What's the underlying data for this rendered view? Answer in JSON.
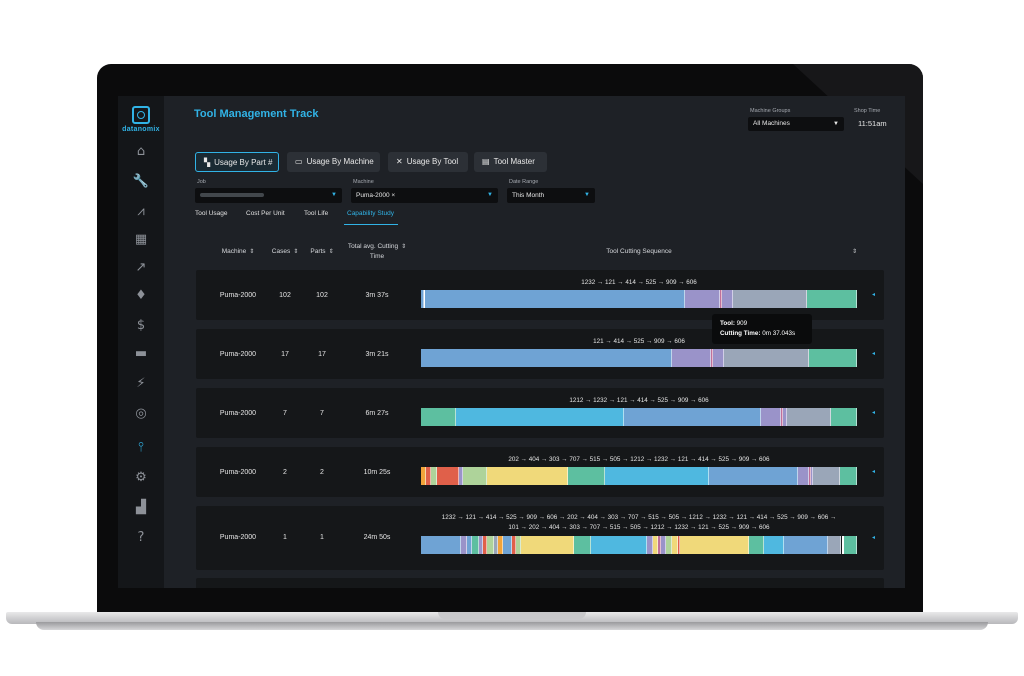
{
  "app": {
    "logo_text": "datanomix",
    "page_title": "Tool Management Track"
  },
  "header": {
    "machine_groups_label": "Machine Groups",
    "machine_groups_value": "All Machines",
    "shop_time_label": "Shop Time",
    "shop_time_value": "11:51am"
  },
  "sidebar": {
    "items": [
      {
        "name": "home-icon",
        "glyph": "⌂"
      },
      {
        "name": "wrench-icon",
        "glyph": "🔧"
      },
      {
        "name": "road-icon",
        "glyph": "⩘"
      },
      {
        "name": "machine-icon",
        "glyph": "▦"
      },
      {
        "name": "trend-icon",
        "glyph": "↗"
      },
      {
        "name": "award-icon",
        "glyph": "♦"
      },
      {
        "name": "dollar-icon",
        "glyph": "$"
      },
      {
        "name": "truck-icon",
        "glyph": "▬"
      },
      {
        "name": "chart-person-icon",
        "glyph": "⚡"
      },
      {
        "name": "search-gear-icon",
        "glyph": "◎"
      },
      {
        "name": "tool-icon",
        "glyph": "⫯"
      },
      {
        "name": "gear-icon",
        "glyph": "⚙"
      },
      {
        "name": "puzzle-icon",
        "glyph": "▟"
      },
      {
        "name": "help-icon",
        "glyph": "?"
      }
    ],
    "active_index": 10
  },
  "tabs": [
    {
      "label": "Usage By Part #",
      "icon": "part-icon"
    },
    {
      "label": "Usage By Machine",
      "icon": "monitor-icon"
    },
    {
      "label": "Usage By Tool",
      "icon": "tools-icon"
    },
    {
      "label": "Tool Master",
      "icon": "card-icon"
    }
  ],
  "filters": {
    "job_label": "Job",
    "machine_label": "Machine",
    "machine_value": "Puma-2000 ×",
    "date_range_label": "Date Range",
    "date_range_value": "This Month"
  },
  "subtabs": [
    "Tool Usage",
    "Cost Per Unit",
    "Tool Life",
    "Capability Study"
  ],
  "table": {
    "headers": {
      "machine": "Machine",
      "cases": "Cases",
      "parts": "Parts",
      "time_line1": "Total avg. Cutting",
      "time_line2": "Time",
      "sequence": "Tool Cutting Sequence"
    },
    "rows": [
      {
        "machine": "Puma-2000",
        "cases": "102",
        "parts": "102",
        "time": "3m 37s",
        "sequence": [
          "1232 → 121 → 414 → 525 → 909 → 606"
        ],
        "segments": [
          [
            "#6fa3d4",
            0.6
          ],
          [
            "#ffffff",
            0.4
          ],
          [
            "#6fa3d4",
            59.5
          ],
          [
            "#9a93c9",
            8
          ],
          [
            "#c0709a",
            0.5
          ],
          [
            "#9a93c9",
            2.5
          ],
          [
            "#9aa6b8",
            17
          ],
          [
            "#5dbfa0",
            11.5
          ]
        ]
      },
      {
        "machine": "Puma-2000",
        "cases": "17",
        "parts": "17",
        "time": "3m 21s",
        "sequence": [
          "121 → 414 → 525 → 909 → 606"
        ],
        "segments": [
          [
            "#6fa3d4",
            57.5
          ],
          [
            "#9a93c9",
            9
          ],
          [
            "#c0709a",
            0.5
          ],
          [
            "#9a93c9",
            2.5
          ],
          [
            "#9aa6b8",
            19.5
          ],
          [
            "#5dbfa0",
            11
          ]
        ]
      },
      {
        "machine": "Puma-2000",
        "cases": "7",
        "parts": "7",
        "time": "6m 27s",
        "sequence": [
          "1212 → 1232 → 121 → 414 → 525 → 909 → 606"
        ],
        "segments": [
          [
            "#5dbfa0",
            8
          ],
          [
            "#4fb8e0",
            38.5
          ],
          [
            "#6fa3d4",
            31.5
          ],
          [
            "#9a93c9",
            4.5
          ],
          [
            "#c0709a",
            0.5
          ],
          [
            "#9a93c9",
            1
          ],
          [
            "#9aa6b8",
            10
          ],
          [
            "#5dbfa0",
            6
          ]
        ]
      },
      {
        "machine": "Puma-2000",
        "cases": "2",
        "parts": "2",
        "time": "10m 25s",
        "sequence": [
          "202 → 404 → 303 → 707 → 515 → 505 → 1212 → 1232 → 121 → 414 → 525 → 909 → 606"
        ],
        "segments": [
          [
            "#f2a43a",
            1.2
          ],
          [
            "#e0604a",
            1
          ],
          [
            "#aed39a",
            1.5
          ],
          [
            "#e0604a",
            5
          ],
          [
            "#9a93c9",
            1
          ],
          [
            "#aed39a",
            5.5
          ],
          [
            "#f0d97a",
            18.5
          ],
          [
            "#5dbfa0",
            8.5
          ],
          [
            "#4fb8e0",
            24
          ],
          [
            "#6fa3d4",
            20.5
          ],
          [
            "#9a93c9",
            2.5
          ],
          [
            "#c0709a",
            0.5
          ],
          [
            "#9a93c9",
            0.5
          ],
          [
            "#9aa6b8",
            6
          ],
          [
            "#5dbfa0",
            4
          ]
        ]
      },
      {
        "machine": "Puma-2000",
        "cases": "1",
        "parts": "1",
        "time": "24m 50s",
        "sequence": [
          "1232 → 121 → 414 → 525 → 909 → 606 → 202 → 404 → 303 → 707 → 515 → 505 → 1212 → 1232 → 121 → 414 → 525 → 909 → 606 →",
          "101 → 202 → 404 → 303 → 707 → 515 → 505 → 1212 → 1232 → 121 → 525 → 909 → 606"
        ],
        "segments": [
          [
            "#6fa3d4",
            9
          ],
          [
            "#9a93c9",
            1.5
          ],
          [
            "#6fa3d4",
            1
          ],
          [
            "#5dbfa0",
            1.5
          ],
          [
            "#9a93c9",
            1
          ],
          [
            "#e0604a",
            1
          ],
          [
            "#aed39a",
            1.5
          ],
          [
            "#9aa6b8",
            1
          ],
          [
            "#f2a43a",
            1
          ],
          [
            "#6fa3d4",
            2
          ],
          [
            "#e0604a",
            1
          ],
          [
            "#aed39a",
            1
          ],
          [
            "#f0d97a",
            12
          ],
          [
            "#5dbfa0",
            4
          ],
          [
            "#4fb8e0",
            12.5
          ],
          [
            "#9a93c9",
            1.5
          ],
          [
            "#f0d97a",
            1
          ],
          [
            "#c0709a",
            0.8
          ],
          [
            "#9a93c9",
            1
          ],
          [
            "#aed39a",
            1.5
          ],
          [
            "#f0d97a",
            1.2
          ],
          [
            "#e0604a",
            0.5
          ],
          [
            "#f0d97a",
            15.5
          ],
          [
            "#5dbfa0",
            3.5
          ],
          [
            "#4fb8e0",
            4.5
          ],
          [
            "#6fa3d4",
            10
          ],
          [
            "#9aa6b8",
            3
          ],
          [
            "#ffffff",
            0.5
          ],
          [
            "#5dbfa0",
            3
          ]
        ]
      }
    ]
  },
  "tooltip": {
    "tool_label": "Tool:",
    "tool_value": "909",
    "time_label": "Cutting Time:",
    "time_value": "0m 37.043s"
  }
}
